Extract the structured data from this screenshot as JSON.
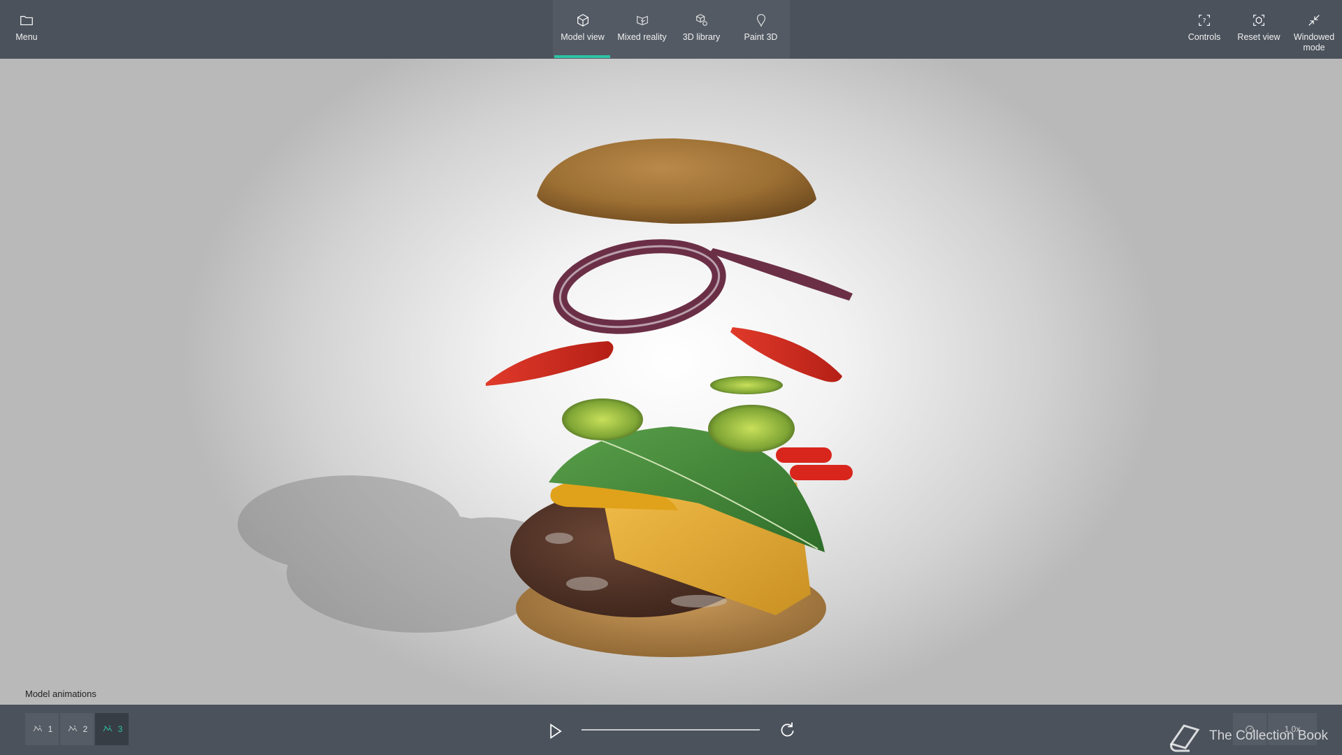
{
  "topbar": {
    "menu_label": "Menu",
    "tabs": [
      {
        "label": "Model view",
        "icon": "cube-icon",
        "active": true
      },
      {
        "label": "Mixed reality",
        "icon": "mixed-reality-icon",
        "active": false
      },
      {
        "label": "3D library",
        "icon": "library-icon",
        "active": false
      },
      {
        "label": "Paint 3D",
        "icon": "paint3d-icon",
        "active": false
      }
    ],
    "controls_label": "Controls",
    "reset_view_label": "Reset view",
    "windowed_mode_label": "Windowed\nmode"
  },
  "animations": {
    "label": "Model animations",
    "items": [
      {
        "label": "1",
        "active": false
      },
      {
        "label": "2",
        "active": false
      },
      {
        "label": "3",
        "active": true
      }
    ]
  },
  "playback": {
    "speed_label": "1.0x"
  },
  "watermark": {
    "text": "The Collection Book"
  },
  "colors": {
    "accent": "#2ec4a5",
    "bar_background": "#4b525c"
  }
}
